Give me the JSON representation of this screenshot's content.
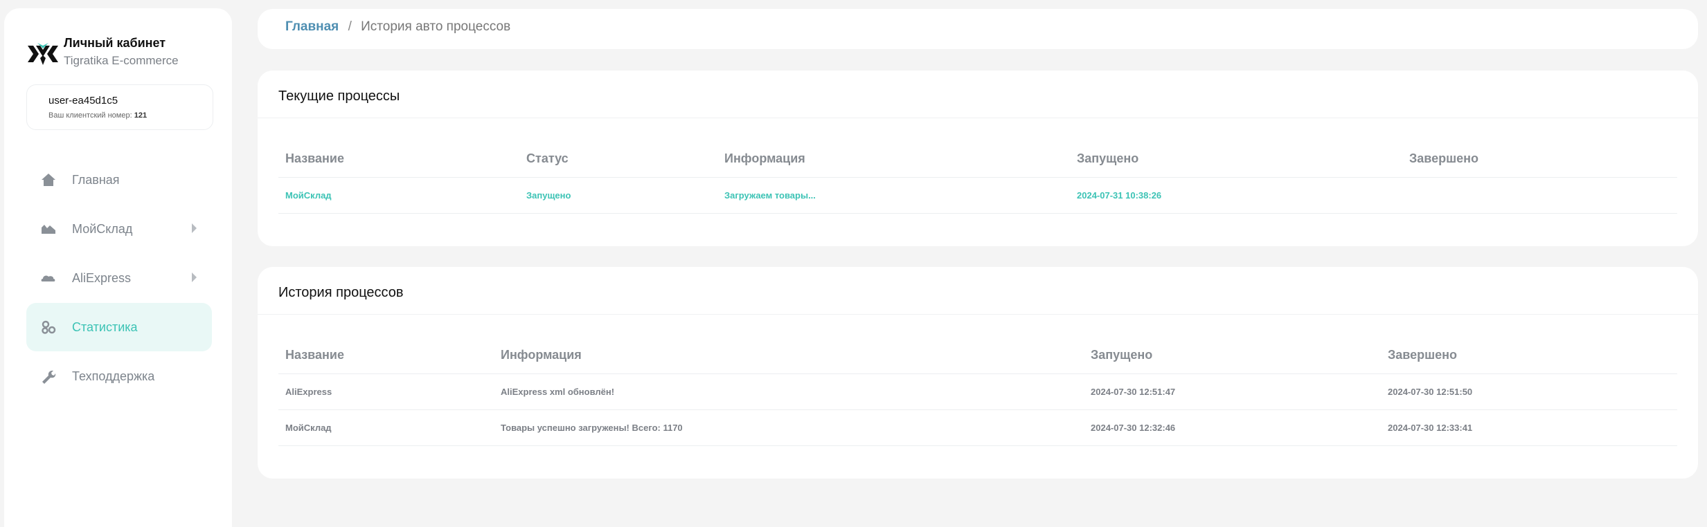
{
  "brand": {
    "title": "Личный кабинет",
    "subtitle": "Tigratika E-commerce"
  },
  "user": {
    "name": "user-ea45d1c5",
    "client_label": "Ваш клиентский номер:",
    "client_number": "121"
  },
  "sidebar": {
    "items": [
      {
        "label": "Главная",
        "icon": "home-icon"
      },
      {
        "label": "МойСклад",
        "icon": "mountain-icon",
        "submenu": true
      },
      {
        "label": "AliExpress",
        "icon": "cloud-icon",
        "submenu": true
      },
      {
        "label": "Статистика",
        "icon": "stats-icon",
        "active": true
      },
      {
        "label": "Техподдержка",
        "icon": "wrench-icon"
      }
    ]
  },
  "breadcrumb": {
    "home": "Главная",
    "separator": "/",
    "current": "История авто процессов"
  },
  "current_processes": {
    "title": "Текущие процессы",
    "columns": [
      "Название",
      "Статус",
      "Информация",
      "Запущено",
      "Завершено"
    ],
    "rows": [
      [
        "МойСклад",
        "Запущено",
        "Загружаем товары...",
        "2024-07-31 10:38:26",
        ""
      ]
    ]
  },
  "history": {
    "title": "История процессов",
    "columns": [
      "Название",
      "Информация",
      "Запущено",
      "Завершено"
    ],
    "rows": [
      [
        "AliExpress",
        "AliExpress xml обновлён!",
        "2024-07-30 12:51:47",
        "2024-07-30 12:51:50"
      ],
      [
        "МойСклад",
        "Товары успешно загружены! Всего: 1170",
        "2024-07-30 12:32:46",
        "2024-07-30 12:33:41"
      ]
    ]
  },
  "colors": {
    "accent": "#3cc3b5",
    "link": "#4f8fb2",
    "background": "#f4f4f4"
  }
}
